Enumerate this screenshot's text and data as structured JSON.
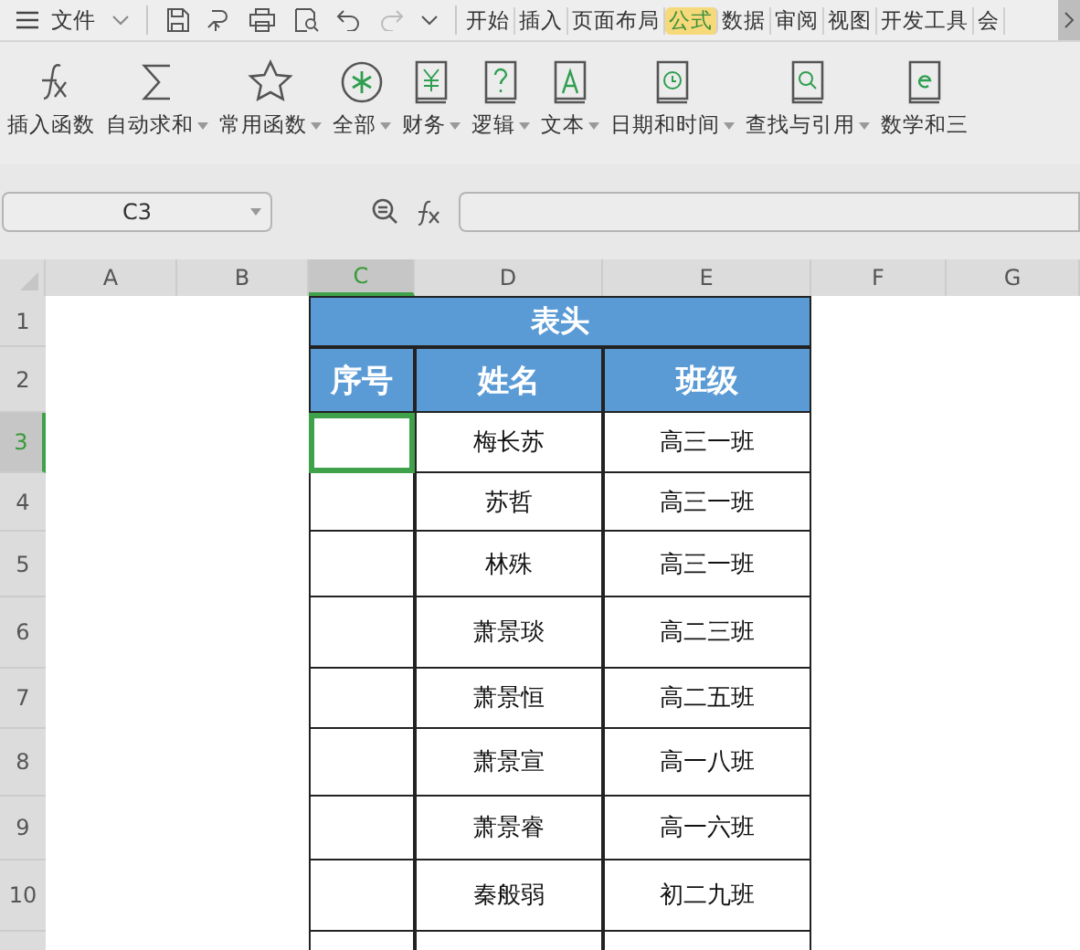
{
  "menu": {
    "file_label": "文件"
  },
  "tabs": [
    {
      "label": "开始",
      "selected": false
    },
    {
      "label": "插入",
      "selected": false
    },
    {
      "label": "页面布局",
      "selected": false
    },
    {
      "label": "公式",
      "selected": true
    },
    {
      "label": "数据",
      "selected": false
    },
    {
      "label": "审阅",
      "selected": false
    },
    {
      "label": "视图",
      "selected": false
    },
    {
      "label": "开发工具",
      "selected": false
    },
    {
      "label": "会",
      "selected": false
    }
  ],
  "ribbon": [
    {
      "kind": "fx",
      "label": "插入函数",
      "dropdown": false
    },
    {
      "kind": "sum",
      "label": "自动求和",
      "dropdown": true
    },
    {
      "kind": "star",
      "label": "常用函数",
      "dropdown": true
    },
    {
      "kind": "all",
      "label": "全部",
      "dropdown": true
    },
    {
      "kind": "book-yen",
      "label": "财务",
      "dropdown": true
    },
    {
      "kind": "book-q",
      "label": "逻辑",
      "dropdown": true
    },
    {
      "kind": "book-a",
      "label": "文本",
      "dropdown": true
    },
    {
      "kind": "book-clock",
      "label": "日期和时间",
      "dropdown": true
    },
    {
      "kind": "book-search",
      "label": "查找与引用",
      "dropdown": true
    },
    {
      "kind": "book-e",
      "label": "数学和三",
      "dropdown": false
    }
  ],
  "name_box": "C3",
  "columns": [
    {
      "label": "A",
      "selected": false
    },
    {
      "label": "B",
      "selected": false
    },
    {
      "label": "C",
      "selected": true
    },
    {
      "label": "D",
      "selected": false
    },
    {
      "label": "E",
      "selected": false
    },
    {
      "label": "F",
      "selected": false
    },
    {
      "label": "G",
      "selected": false
    }
  ],
  "row_numbers": [
    {
      "label": "1",
      "selected": false
    },
    {
      "label": "2",
      "selected": false
    },
    {
      "label": "3",
      "selected": true
    },
    {
      "label": "4",
      "selected": false
    },
    {
      "label": "5",
      "selected": false
    },
    {
      "label": "6",
      "selected": false
    },
    {
      "label": "7",
      "selected": false
    },
    {
      "label": "8",
      "selected": false
    },
    {
      "label": "9",
      "selected": false
    },
    {
      "label": "10",
      "selected": false
    }
  ],
  "table": {
    "title": "表头",
    "headers": [
      "序号",
      "姓名",
      "班级"
    ],
    "rows": [
      {
        "name": "梅长苏",
        "class": "高三一班"
      },
      {
        "name": "苏哲",
        "class": "高三一班"
      },
      {
        "name": "林殊",
        "class": "高三一班"
      },
      {
        "name": "萧景琰",
        "class": "高二三班"
      },
      {
        "name": "萧景恒",
        "class": "高二五班"
      },
      {
        "name": "萧景宣",
        "class": "高一八班"
      },
      {
        "name": "萧景睿",
        "class": "高一六班"
      },
      {
        "name": "秦般弱",
        "class": "初二九班"
      }
    ]
  }
}
